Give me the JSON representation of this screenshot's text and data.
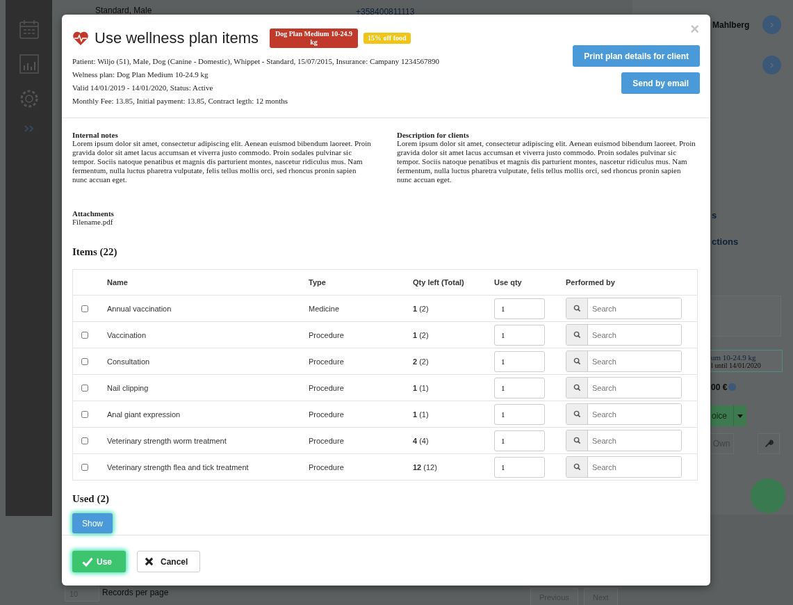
{
  "background": {
    "patient_line": "Standard, Male",
    "phone": "+358400811113",
    "owner_name": "Mahlberg",
    "section_1": "s",
    "section_2": "ctions",
    "plan_card": {
      "title": "um 10-24.9 kg",
      "subtitle": "l until 14/01/2020"
    },
    "total": "00 €",
    "invoice_button": "oice",
    "own_button": "Own",
    "page_size": "10",
    "page_size_label": "Records per page",
    "previous": "Previous",
    "next": "Next"
  },
  "modal": {
    "title": "Use wellness plan items",
    "badges": [
      {
        "label": "Dog Plan Medium 10-24.9 kg",
        "color": "#c0392b"
      },
      {
        "label": "15% off food",
        "color": "#f0c419"
      }
    ],
    "info_lines": [
      "Patient: Wiljo (51), Male, Dog (Canine - Domestic), Whippet - Standard, 15/07/2015, Insurance: Campany 1234567890",
      "Welness plan: Dog Plan Medium 10-24.9 kg",
      "Valid 14/01/2019 - 14/01/2020, Status: Active",
      "Monthly Fee: 13.85, Initial payment: 13.85, Contract legth: 12 months"
    ],
    "actions": [
      "Print plan details for client",
      "Send by email"
    ],
    "close": "×",
    "notes": [
      {
        "title": "Internal notes",
        "text": "Lorem ipsum dolor sit amet, consectetur adipiscing elit. Aenean euismod bibendum laoreet. Proin gravida dolor sit amet lacus accumsan et viverra justo commodo. Proin sodales pulvinar sic tempor. Sociis natoque penatibus et magnis dis parturient montes, nascetur ridiculus mus. Nam fermentum, nulla luctus pharetra vulputate, felis tellus mollis orci, sed rhoncus pronin sapien nunc accuan eget."
      },
      {
        "title": "Description for clients",
        "text": "Lorem ipsum dolor sit amet, consectetur adipiscing elit. Aenean euismod bibendum laoreet. Proin gravida dolor sit amet lacus accumsan et viverra justo commodo. Proin sodales pulvinar sic tempor. Sociis natoque penatibus et magnis dis parturient montes, nascetur ridiculus mus. Nam fermentum, nulla luctus pharetra vulputate, felis tellus mollis orci, sed rhoncus pronin sapien nunc accuan eget."
      }
    ],
    "attachments": {
      "title": "Attachments",
      "files": [
        "Filename.pdf"
      ]
    },
    "items_heading": "Items (22)",
    "table": {
      "columns": [
        "Name",
        "Type",
        "Qty left (Total)",
        "Use qty",
        "Performed by"
      ],
      "rows": [
        {
          "checked": false,
          "name": "Annual vaccination",
          "type": "Medicine",
          "qty_left": "1",
          "qty_total": "(2)",
          "use_qty": "1",
          "performed_by_placeholder": "Search"
        },
        {
          "checked": false,
          "name": "Vaccination",
          "type": "Procedure",
          "qty_left": "1",
          "qty_total": "(2)",
          "use_qty": "1",
          "performed_by_placeholder": "Search"
        },
        {
          "checked": false,
          "name": "Consultation",
          "type": "Procedure",
          "qty_left": "2",
          "qty_total": "(2)",
          "use_qty": "1",
          "performed_by_placeholder": "Search"
        },
        {
          "checked": false,
          "name": "Nail clipping",
          "type": "Procedure",
          "qty_left": "1",
          "qty_total": "(1)",
          "use_qty": "1",
          "performed_by_placeholder": "Search"
        },
        {
          "checked": false,
          "name": "Anal giant expression",
          "type": "Procedure",
          "qty_left": "1",
          "qty_total": "(1)",
          "use_qty": "1",
          "performed_by_placeholder": "Search"
        },
        {
          "checked": false,
          "name": "Veterinary strength worm treatment",
          "type": "Procedure",
          "qty_left": "4",
          "qty_total": "(4)",
          "use_qty": "1",
          "performed_by_placeholder": "Search"
        },
        {
          "checked": false,
          "name": "Veterinary strength flea and tick treatment",
          "type": "Procedure",
          "qty_left": "12",
          "qty_total": "(12)",
          "use_qty": "1",
          "performed_by_placeholder": "Search"
        }
      ]
    },
    "used_heading": "Used (2)",
    "show_button": "Show",
    "footer": {
      "use": "Use",
      "cancel": "Cancel"
    }
  }
}
